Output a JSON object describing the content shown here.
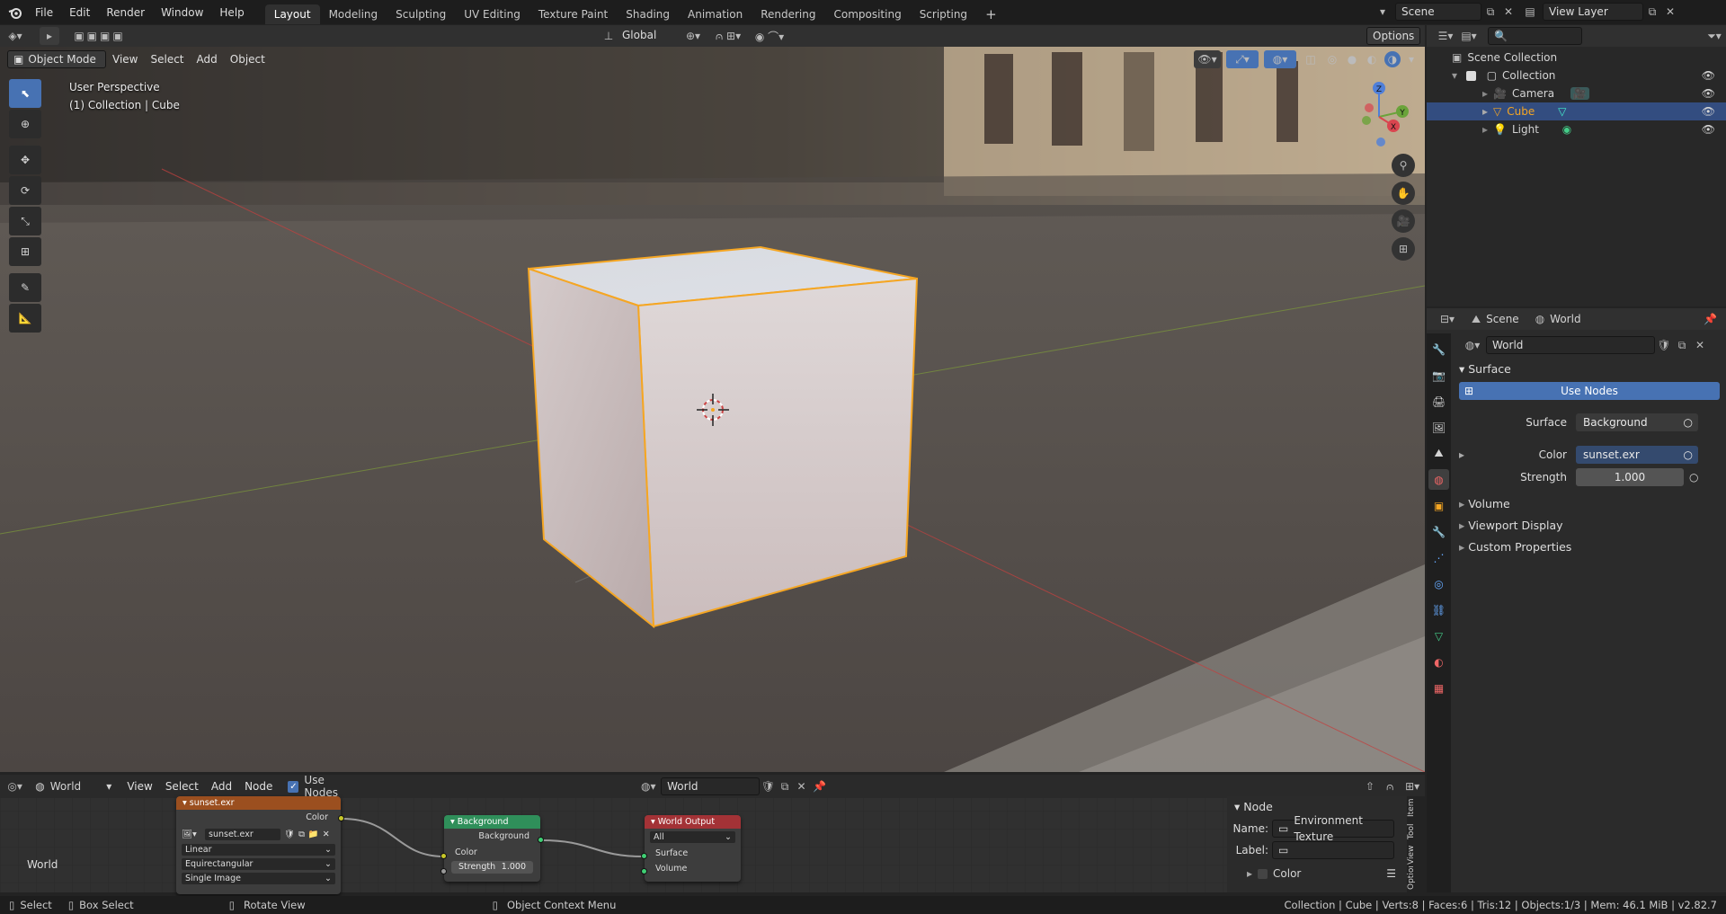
{
  "topbar": {
    "menus": [
      "File",
      "Edit",
      "Render",
      "Window",
      "Help"
    ],
    "workspaces": [
      "Layout",
      "Modeling",
      "Sculpting",
      "UV Editing",
      "Texture Paint",
      "Shading",
      "Animation",
      "Rendering",
      "Compositing",
      "Scripting"
    ],
    "active_workspace": "Layout",
    "scene": "Scene",
    "view_layer": "View Layer"
  },
  "viewport": {
    "toolheader": {
      "transform": "Global",
      "options": "Options"
    },
    "header": {
      "mode": "Object Mode",
      "menus": [
        "View",
        "Select",
        "Add",
        "Object"
      ]
    },
    "info_line1": "User Perspective",
    "info_line2": "(1) Collection | Cube",
    "gizmo": {
      "x": "X",
      "y": "Y",
      "z": "Z"
    }
  },
  "outliner": {
    "search_placeholder": "",
    "root": "Scene Collection",
    "collection": "Collection",
    "items": [
      {
        "name": "Camera"
      },
      {
        "name": "Cube"
      },
      {
        "name": "Light"
      }
    ]
  },
  "properties": {
    "breadcrumb_scene": "Scene",
    "breadcrumb_world": "World",
    "world_name": "World",
    "surface_panel": "Surface",
    "use_nodes": "Use Nodes",
    "surface_label": "Surface",
    "surface_value": "Background",
    "color_label": "Color",
    "color_value": "sunset.exr",
    "strength_label": "Strength",
    "strength_value": "1.000",
    "panels": [
      "Volume",
      "Viewport Display",
      "Custom Properties"
    ]
  },
  "node_editor": {
    "type": "World",
    "menus": [
      "View",
      "Select",
      "Add",
      "Node"
    ],
    "use_nodes": "Use Nodes",
    "world": "World",
    "canvas_label": "World",
    "tex_node": {
      "title": "sunset.exr",
      "out": "Color",
      "image": "sunset.exr",
      "interp": "Linear",
      "proj": "Equirectangular",
      "src": "Single Image"
    },
    "bg_node": {
      "title": "Background",
      "out": "Background",
      "color": "Color",
      "strength": "Strength",
      "strength_val": "1.000"
    },
    "out_node": {
      "title": "World Output",
      "target": "All",
      "surface": "Surface",
      "volume": "Volume"
    },
    "sidebar": {
      "panel": "Node",
      "name_label": "Name:",
      "name_value": "Environment Texture",
      "label_label": "Label:",
      "color": "Color",
      "tabs": [
        "Item",
        "Tool",
        "View",
        "Options"
      ]
    }
  },
  "status": {
    "select": "Select",
    "box_select": "Box Select",
    "rotate": "Rotate View",
    "context": "Object Context Menu",
    "info": "Collection | Cube | Verts:8 | Faces:6 | Tris:12 | Objects:1/3 | Mem: 46.1 MiB | v2.82.7"
  },
  "colors": {
    "accent": "#4772b3",
    "selected_row": "#334d80",
    "orange": "#f5a623",
    "texture_node": "#9b4f1f",
    "shader_node": "#2f8f5a",
    "output_node": "#a33236"
  }
}
